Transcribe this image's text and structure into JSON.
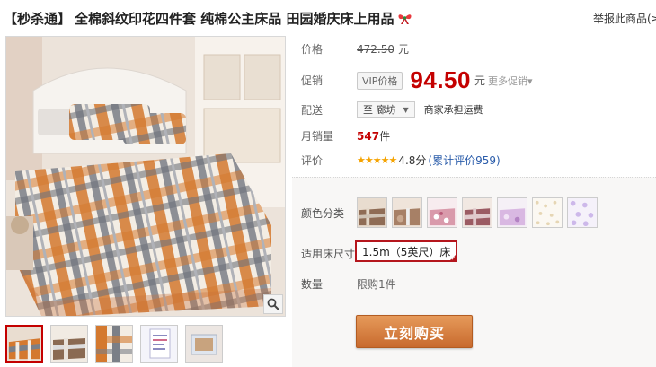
{
  "product": {
    "tag": "【秒杀通】",
    "title": "全棉斜纹印花四件套 纯棉公主床品 田园婚庆床上用品",
    "gift_icon": "gift-bow-icon",
    "report_link": "举报此商品(≥"
  },
  "gallery": {
    "zoom_icon": "magnifier-icon",
    "thumbnail_count": 5,
    "active_thumbnail": 0
  },
  "info": {
    "price_label": "价格",
    "price_value": "472.50",
    "yuan": "元",
    "promo_label": "促销",
    "vip_tag": "VIP价格",
    "promo_price": "94.50",
    "promo_yuan": "元",
    "more_promo": "更多促销▾",
    "delivery_label": "配送",
    "delivery_to": "至 廊坊",
    "delivery_caret": "▼",
    "shipping_note": "商家承担运费",
    "monthly_sales_label": "月销量",
    "monthly_sales_value": "547",
    "monthly_sales_unit": "件",
    "rating_label": "评价",
    "rating_stars": "★★★★★",
    "rating_score": "4.8分",
    "reviews": "(累计评价959)",
    "rating_value": 4.8
  },
  "options": {
    "color_label": "颜色分类",
    "size_label": "适用床尺寸",
    "size_value": "1.5m（5英尺）床",
    "quantity_label": "数量",
    "quantity_limit": "限购1件",
    "buy_button": "立刻购买"
  },
  "colors": {
    "accent_red": "#c40000",
    "buy_orange": "#d6803f",
    "link_blue": "#2a5caa"
  }
}
